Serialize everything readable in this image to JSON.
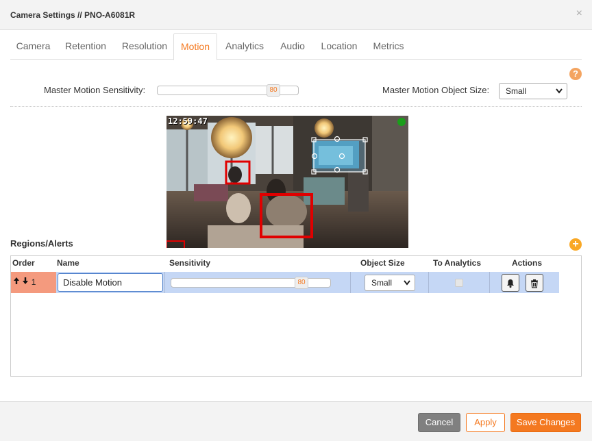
{
  "dialog": {
    "title": "Camera Settings // PNO-A6081R",
    "close": "×"
  },
  "tabs": [
    {
      "label": "Camera"
    },
    {
      "label": "Retention"
    },
    {
      "label": "Resolution"
    },
    {
      "label": "Motion"
    },
    {
      "label": "Analytics"
    },
    {
      "label": "Audio"
    },
    {
      "label": "Location"
    },
    {
      "label": "Metrics"
    }
  ],
  "active_tab": "Motion",
  "help_icon": "?",
  "master": {
    "sensitivity_label": "Master Motion Sensitivity:",
    "sensitivity_value": "80",
    "object_size_label": "Master Motion Object Size:",
    "object_size_value": "Small"
  },
  "camera": {
    "timestamp": "12:59:47",
    "status_color": "#1a9e1a"
  },
  "regions": {
    "title": "Regions/Alerts",
    "add_icon": "+",
    "columns": [
      "Order",
      "Name",
      "Sensitivity",
      "Object Size",
      "To Analytics",
      "Actions"
    ],
    "rows": [
      {
        "order": "1",
        "name": "Disable Motion",
        "sensitivity": "80",
        "object_size": "Small",
        "to_analytics": false
      }
    ]
  },
  "footer": {
    "cancel": "Cancel",
    "apply": "Apply",
    "save": "Save Changes"
  },
  "colors": {
    "accent": "#f47920",
    "row_highlight": "#c5d7f5",
    "order_cell": "#f49a7e",
    "motion_box": "#e00000"
  }
}
